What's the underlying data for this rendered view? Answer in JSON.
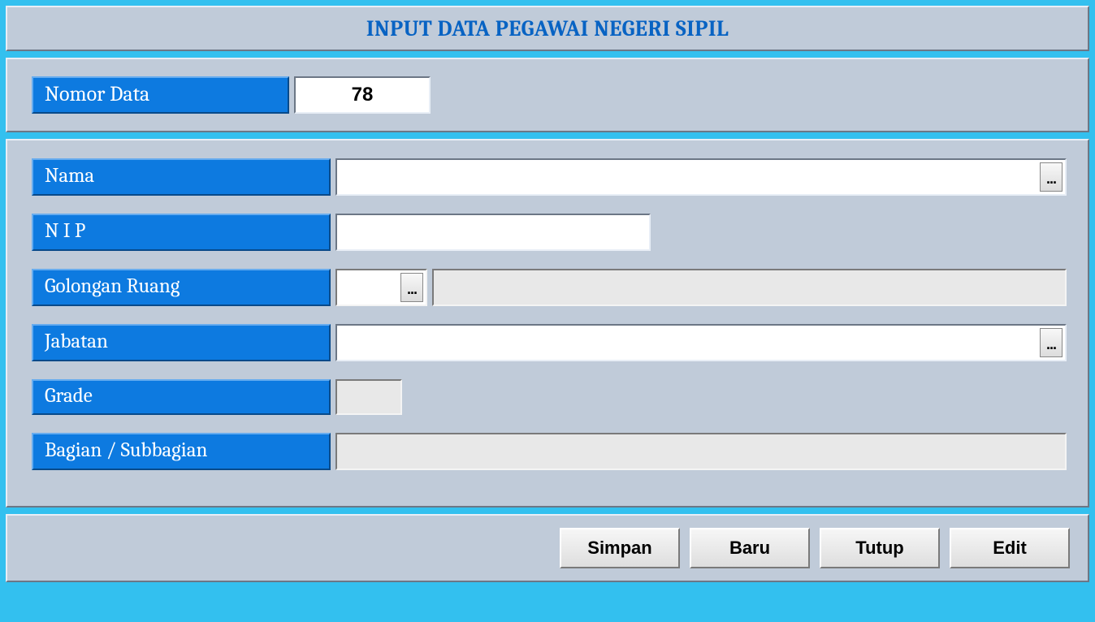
{
  "title": "INPUT DATA PEGAWAI NEGERI SIPIL",
  "nomor": {
    "label": "Nomor Data",
    "value": "78"
  },
  "fields": {
    "nama": {
      "label": "Nama",
      "value": ""
    },
    "nip": {
      "label": "N I P",
      "value": ""
    },
    "gol": {
      "label": "Golongan Ruang",
      "value1": "",
      "value2": ""
    },
    "jabatan": {
      "label": "Jabatan",
      "value": ""
    },
    "grade": {
      "label": "Grade",
      "value": ""
    },
    "bagian": {
      "label": "Bagian / Subbagian",
      "value": ""
    }
  },
  "picker_glyph": "...",
  "buttons": {
    "simpan": "Simpan",
    "baru": "Baru",
    "tutup": "Tutup",
    "edit": "Edit"
  }
}
